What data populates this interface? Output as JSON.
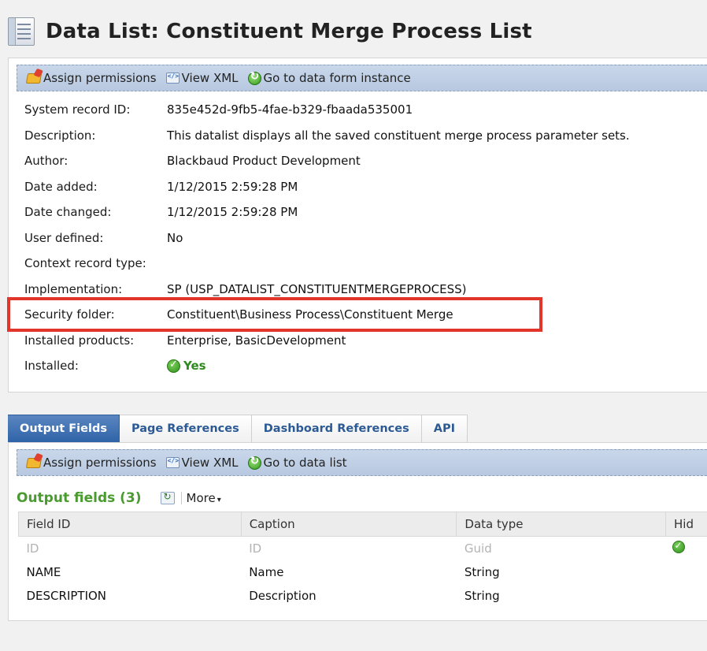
{
  "header": {
    "title": "Data List: Constituent Merge Process List",
    "icon": "document-list-icon"
  },
  "top_actions": {
    "assign_permissions": "Assign permissions",
    "view_xml": "View XML",
    "go_to": "Go to data form instance"
  },
  "properties": [
    {
      "label": "System record ID:",
      "value": "835e452d-9fb5-4fae-b329-fbaada535001"
    },
    {
      "label": "Description:",
      "value": "This datalist displays all the saved constituent merge process parameter sets."
    },
    {
      "label": "Author:",
      "value": "Blackbaud Product Development"
    },
    {
      "label": "Date added:",
      "value": "1/12/2015 2:59:28 PM"
    },
    {
      "label": "Date changed:",
      "value": "1/12/2015 2:59:28 PM"
    },
    {
      "label": "User defined:",
      "value": "No"
    },
    {
      "label": "Context record type:",
      "value": ""
    },
    {
      "label": "Implementation:",
      "value": "SP (USP_DATALIST_CONSTITUENTMERGEPROCESS)"
    },
    {
      "label": "Security folder:",
      "value": "Constituent\\Business Process\\Constituent Merge"
    },
    {
      "label": "Installed products:",
      "value": "Enterprise, BasicDevelopment"
    },
    {
      "label": "Installed:",
      "value": "Yes"
    }
  ],
  "tabs": [
    {
      "label": "Output Fields",
      "active": true
    },
    {
      "label": "Page References",
      "active": false
    },
    {
      "label": "Dashboard References",
      "active": false
    },
    {
      "label": "API",
      "active": false
    }
  ],
  "bottom_actions": {
    "assign_permissions": "Assign permissions",
    "view_xml": "View XML",
    "go_to": "Go to data list"
  },
  "grid": {
    "title": "Output fields (3)",
    "more_label": "More",
    "columns": [
      "Field ID",
      "Caption",
      "Data type",
      "Hid"
    ],
    "rows": [
      {
        "field_id": "ID",
        "caption": "ID",
        "data_type": "Guid",
        "hidden": true
      },
      {
        "field_id": "NAME",
        "caption": "Name",
        "data_type": "String",
        "hidden": false
      },
      {
        "field_id": "DESCRIPTION",
        "caption": "Description",
        "data_type": "String",
        "hidden": false
      }
    ]
  },
  "colors": {
    "highlight": "#e3362b",
    "active_tab": "#3a6db0",
    "grid_title": "#4a9b2f"
  }
}
